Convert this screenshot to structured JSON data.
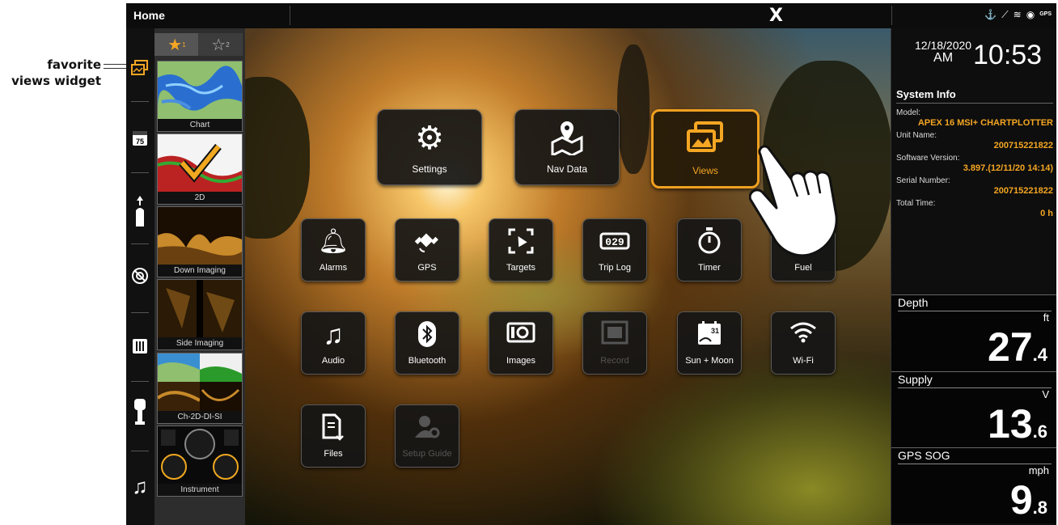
{
  "annotation": {
    "line1": "favorite",
    "line2": "views widget"
  },
  "topbar": {
    "title": "Home",
    "logo": "X"
  },
  "favorites": {
    "tab_active": "★",
    "tab_active_sub": "1",
    "tab_inactive": "☆",
    "tab_inactive_sub": "2",
    "tiles": [
      {
        "label": "Chart"
      },
      {
        "label": "2D"
      },
      {
        "label": "Down Imaging"
      },
      {
        "label": "Side Imaging"
      },
      {
        "label": "Ch-2D-DI-SI"
      },
      {
        "label": "Instrument"
      }
    ]
  },
  "apps": {
    "settings": "Settings",
    "nav_data": "Nav Data",
    "views": "Views",
    "alarms": "Alarms",
    "gps": "GPS",
    "targets": "Targets",
    "trip_log": "Trip Log",
    "timer": "Timer",
    "fuel": "Fuel",
    "audio": "Audio",
    "bluetooth": "Bluetooth",
    "images": "Images",
    "record": "Record",
    "sun_moon": "Sun + Moon",
    "wifi": "Wi-Fi",
    "files": "Files",
    "setup_guide": "Setup Guide"
  },
  "icons": {
    "trip_log_digits": "029",
    "sun_moon_day": "31",
    "rail_temp": "75"
  },
  "datetime": {
    "date": "12/18/2020",
    "ampm": "AM",
    "time": "10:53"
  },
  "system_info": {
    "title": "System Info",
    "model_key": "Model:",
    "model": "APEX 16 MSI+ CHARTPLOTTER",
    "unit_name_key": "Unit Name:",
    "unit_name": "200715221822",
    "software_key": "Software Version:",
    "software": "3.897.(12/11/20 14:14)",
    "serial_key": "Serial Number:",
    "serial": "200715221822",
    "total_time_key": "Total Time:",
    "total_time": "0 h"
  },
  "gauges": {
    "depth": {
      "name": "Depth",
      "unit": "ft",
      "whole": "27",
      "decimal": ".4"
    },
    "supply": {
      "name": "Supply",
      "unit": "V",
      "whole": "13",
      "decimal": ".6"
    },
    "gps_sog": {
      "name": "GPS SOG",
      "unit": "mph",
      "whole": "9",
      "decimal": ".8"
    }
  },
  "colors": {
    "accent": "#f5a623",
    "selected_border": "#f0a020"
  }
}
